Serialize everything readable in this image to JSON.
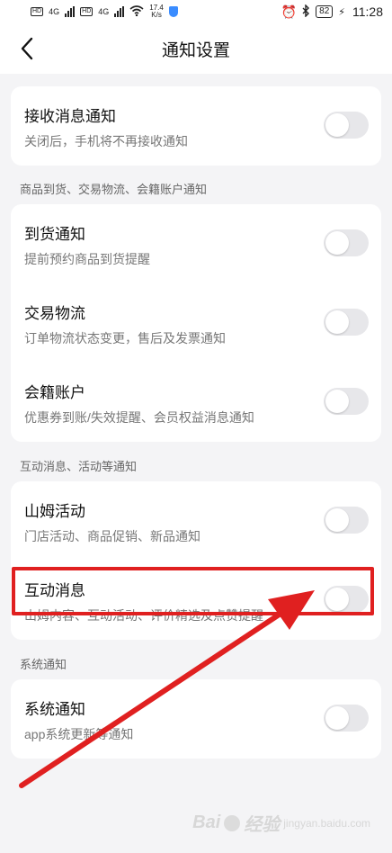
{
  "status_bar": {
    "hd1": "HD",
    "network1": "4G",
    "hd2": "HD",
    "network2": "4G",
    "speed_value": "17.4",
    "speed_unit": "K/s",
    "battery": "82",
    "time": "11:28"
  },
  "nav": {
    "title": "通知设置"
  },
  "main_card": {
    "title": "接收消息通知",
    "subtitle": "关闭后，手机将不再接收通知",
    "enabled": false
  },
  "sections": [
    {
      "label": "商品到货、交易物流、会籍账户通知",
      "items": [
        {
          "title": "到货通知",
          "subtitle": "提前预约商品到货提醒",
          "enabled": false
        },
        {
          "title": "交易物流",
          "subtitle": "订单物流状态变更，售后及发票通知",
          "enabled": false
        },
        {
          "title": "会籍账户",
          "subtitle": "优惠券到账/失效提醒、会员权益消息通知",
          "enabled": false
        }
      ]
    },
    {
      "label": "互动消息、活动等通知",
      "items": [
        {
          "title": "山姆活动",
          "subtitle": "门店活动、商品促销、新品通知",
          "enabled": false
        },
        {
          "title": "互动消息",
          "subtitle": "山姆内容、互动活动、评价精选及点赞提醒",
          "enabled": false
        }
      ]
    },
    {
      "label": "系统通知",
      "items": [
        {
          "title": "系统通知",
          "subtitle": "app系统更新等通知",
          "enabled": false
        }
      ]
    }
  ],
  "watermark": {
    "brand": "Bai",
    "brand2": "经验",
    "sub": "jingyan.baidu.com"
  },
  "colors": {
    "highlight": "#e02020",
    "toggle_off": "#e7e7ea",
    "background": "#f4f4f6"
  }
}
